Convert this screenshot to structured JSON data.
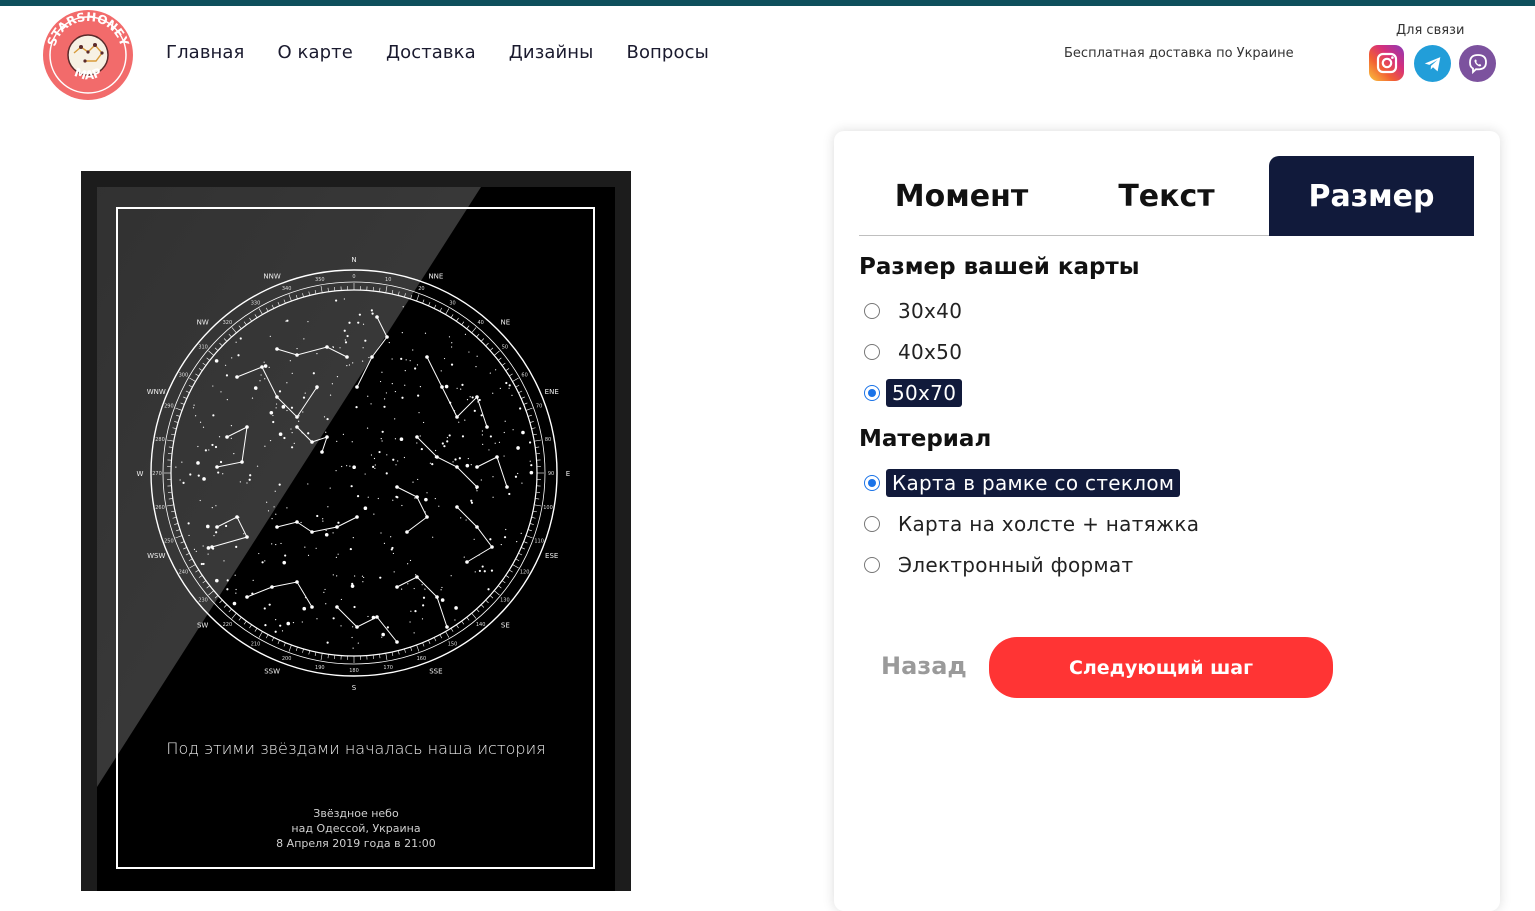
{
  "header": {
    "logo_text_top": "STARSHONEY",
    "logo_text_bottom": "MAP",
    "nav": [
      "Главная",
      "О карте",
      "Доставка",
      "Дизайны",
      "Вопросы"
    ],
    "shipping_text": "Бесплатная доставка по Украине",
    "contact_label": "Для связи",
    "social_icons": [
      "instagram-icon",
      "telegram-icon",
      "viber-icon"
    ]
  },
  "poster": {
    "caption": "Под этими звёздами началась наша история",
    "line1": "Звёздное небо",
    "line2": "над Одессой, Украина",
    "line3": "8 Апреля 2019 года в 21:00",
    "directions": [
      "N",
      "NNE",
      "NE",
      "ENE",
      "E",
      "ESE",
      "SE",
      "SSE",
      "S",
      "SSW",
      "SW",
      "WSW",
      "W",
      "WNW",
      "NW",
      "NNW"
    ],
    "degrees": [
      "350",
      "0",
      "10",
      "20",
      "30",
      "40",
      "50",
      "60",
      "70",
      "80",
      "90",
      "100",
      "110",
      "120",
      "130",
      "140",
      "150",
      "160",
      "170",
      "180",
      "190",
      "200",
      "210",
      "220",
      "230",
      "240",
      "250",
      "260",
      "270",
      "280",
      "290",
      "300",
      "310",
      "320",
      "330",
      "340"
    ]
  },
  "panel": {
    "tabs": [
      "Момент",
      "Текст",
      "Размер"
    ],
    "active_tab": "Размер",
    "size_title": "Размер вашей карты",
    "sizes": [
      {
        "label": "30x40",
        "selected": false
      },
      {
        "label": "40x50",
        "selected": false
      },
      {
        "label": "50x70",
        "selected": true
      }
    ],
    "material_title": "Материал",
    "materials": [
      {
        "label": "Карта в рамке со стеклом",
        "selected": true
      },
      {
        "label": "Карта на холсте + натяжка",
        "selected": false
      },
      {
        "label": "Электронный формат",
        "selected": false
      }
    ],
    "back_label": "Назад",
    "next_label": "Следующий шаг"
  },
  "colors": {
    "accent": "#ff3434",
    "tab_active": "#111a3b",
    "topbar": "#0e4f5c",
    "radio": "#1a73e8"
  }
}
